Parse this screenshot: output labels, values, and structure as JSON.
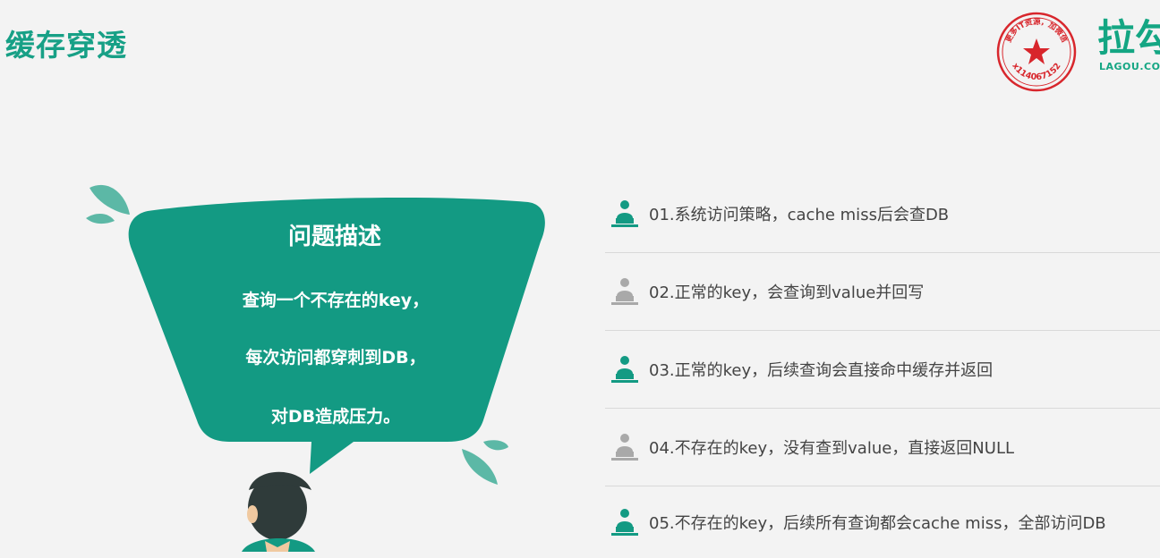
{
  "title": "缓存穿透",
  "stamp": {
    "text": "更多IT资源，加微信",
    "id": "x114067152"
  },
  "brand": {
    "name": "拉勾",
    "domain": "LAGOU.CO"
  },
  "bubble": {
    "heading": "问题描述",
    "lines": [
      "查询一个不存在的key，",
      "每次访问都穿刺到DB，",
      "对DB造成压力。"
    ]
  },
  "colors": {
    "accent": "#16a085",
    "teal_dark": "#0e8f7b",
    "icon_active": "#139a83",
    "icon_muted": "#a9a9a9",
    "stamp_red": "#d8262c"
  },
  "items": [
    {
      "text": "01.系统访问策略，cache miss后会查DB",
      "icon": "presenter-icon",
      "active": true
    },
    {
      "text": "02.正常的key，会查询到value并回写",
      "icon": "presenter-icon",
      "active": false
    },
    {
      "text": "03.正常的key，后续查询会直接命中缓存并返回",
      "icon": "presenter-icon",
      "active": true
    },
    {
      "text": "04.不存在的key，没有查到value，直接返回NULL",
      "icon": "presenter-icon",
      "active": false
    },
    {
      "text": "05.不存在的key，后续所有查询都会cache miss，全部访问DB",
      "icon": "presenter-icon",
      "active": true
    }
  ]
}
